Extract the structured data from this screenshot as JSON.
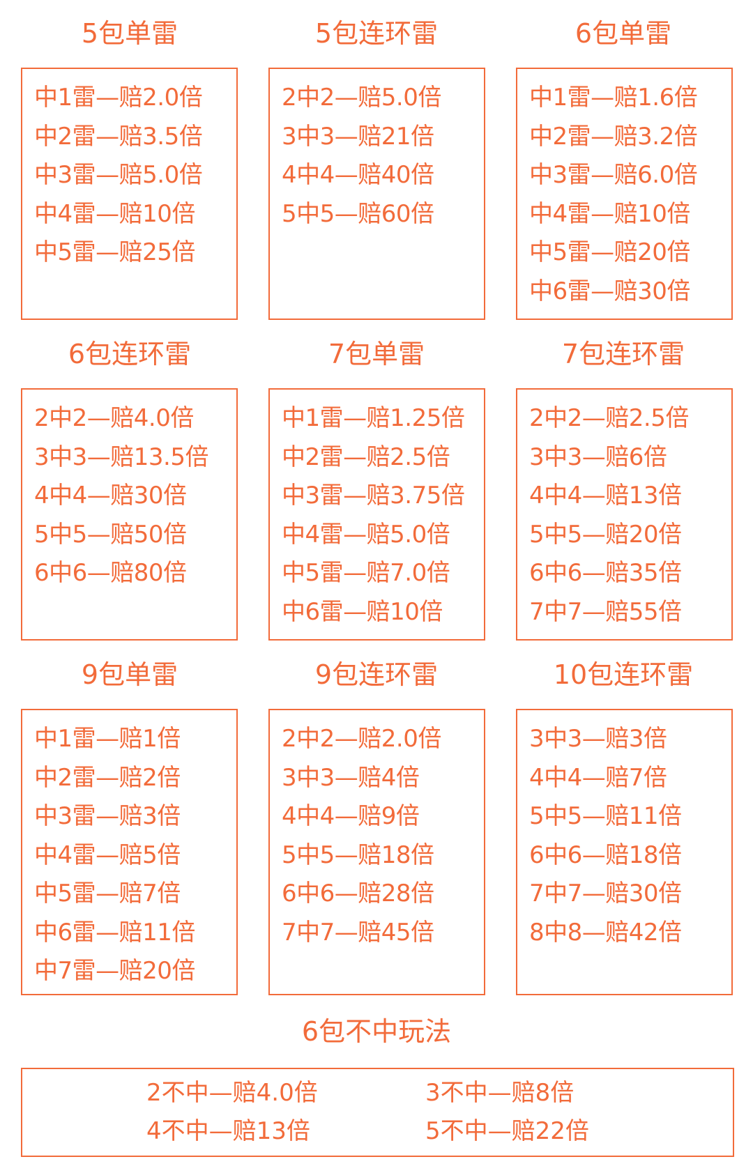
{
  "panels": [
    {
      "title": "5包单雷",
      "lines": [
        "中1雷—赔2.0倍",
        "中2雷—赔3.5倍",
        "中3雷—赔5.0倍",
        "中4雷—赔10倍",
        "中5雷—赔25倍"
      ]
    },
    {
      "title": "5包连环雷",
      "lines": [
        "2中2—赔5.0倍",
        "3中3—赔21倍",
        "4中4—赔40倍",
        "5中5—赔60倍"
      ]
    },
    {
      "title": "6包单雷",
      "lines": [
        "中1雷—赔1.6倍",
        "中2雷—赔3.2倍",
        "中3雷—赔6.0倍",
        "中4雷—赔10倍",
        "中5雷—赔20倍",
        "中6雷—赔30倍"
      ]
    },
    {
      "title": "6包连环雷",
      "lines": [
        "2中2—赔4.0倍",
        "3中3—赔13.5倍",
        "4中4—赔30倍",
        "5中5—赔50倍",
        "6中6—赔80倍"
      ]
    },
    {
      "title": "7包单雷",
      "lines": [
        "中1雷—赔1.25倍",
        "中2雷—赔2.5倍",
        "中3雷—赔3.75倍",
        "中4雷—赔5.0倍",
        "中5雷—赔7.0倍",
        "中6雷—赔10倍"
      ]
    },
    {
      "title": "7包连环雷",
      "lines": [
        "2中2—赔2.5倍",
        "3中3—赔6倍",
        "4中4—赔13倍",
        "5中5—赔20倍",
        "6中6—赔35倍",
        "7中7—赔55倍"
      ]
    },
    {
      "title": "9包单雷",
      "lines": [
        "中1雷—赔1倍",
        "中2雷—赔2倍",
        "中3雷—赔3倍",
        "中4雷—赔5倍",
        "中5雷—赔7倍",
        "中6雷—赔11倍",
        "中7雷—赔20倍"
      ]
    },
    {
      "title": "9包连环雷",
      "lines": [
        "2中2—赔2.0倍",
        "3中3—赔4倍",
        "4中4—赔9倍",
        "5中5—赔18倍",
        "6中6—赔28倍",
        "7中7—赔45倍"
      ]
    },
    {
      "title": "10包连环雷",
      "lines": [
        "3中3—赔3倍",
        "4中4—赔7倍",
        "5中5—赔11倍",
        "6中6—赔18倍",
        "7中7—赔30倍",
        "8中8—赔42倍"
      ]
    }
  ],
  "bottom": {
    "title": "6包不中玩法",
    "lines": [
      "2不中—赔4.0倍",
      "3不中—赔8倍",
      "4不中—赔13倍",
      "5不中—赔22倍"
    ]
  },
  "colors": {
    "accent": "#f26b3a",
    "background": "#ffffff"
  }
}
